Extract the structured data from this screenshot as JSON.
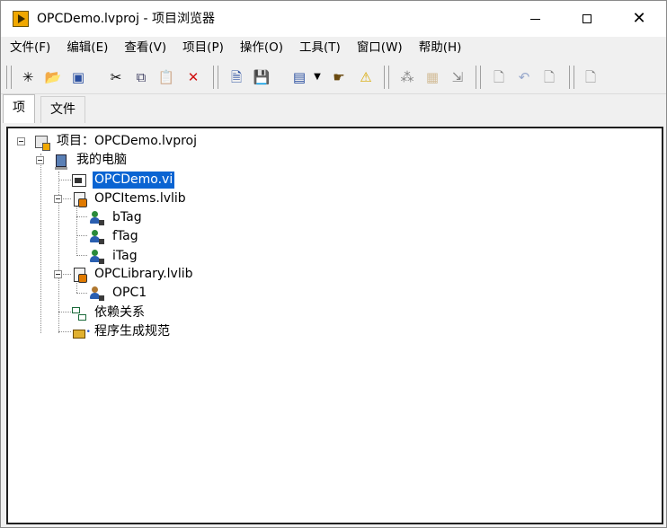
{
  "window": {
    "title": "OPCDemo.lvproj - 项目浏览器"
  },
  "menu": [
    {
      "label": "文件(F)"
    },
    {
      "label": "编辑(E)"
    },
    {
      "label": "查看(V)"
    },
    {
      "label": "项目(P)"
    },
    {
      "label": "操作(O)"
    },
    {
      "label": "工具(T)"
    },
    {
      "label": "窗口(W)"
    },
    {
      "label": "帮助(H)"
    }
  ],
  "toolbar": {
    "icons": [
      "new-icon",
      "open-icon",
      "save-all-icon",
      "cut-icon",
      "copy-icon",
      "paste-icon",
      "delete-icon",
      "add-file-icon",
      "save-icon",
      "view-icon",
      "dropdown-icon",
      "help-icon",
      "warning-icon",
      "filter-icon",
      "build-icon",
      "deploy-icon",
      "refresh-icon",
      "undo-icon",
      "redo-icon",
      "add-item-icon"
    ]
  },
  "tabs": [
    {
      "label": "项"
    },
    {
      "label": "文件"
    }
  ],
  "tree": {
    "project": "项目：OPCDemo.lvproj",
    "computer": "我的电脑",
    "vi": "OPCDemo.vi",
    "items_lib": "OPCItems.lvlib",
    "tag1": "bTag",
    "tag2": "fTag",
    "tag3": "iTag",
    "opc_lib": "OPCLibrary.lvlib",
    "opc1": "OPC1",
    "dependencies": "依赖关系",
    "build_specs": "程序生成规范"
  },
  "colors": {
    "selection": "#0a64d2",
    "accent": "#f0a800"
  }
}
